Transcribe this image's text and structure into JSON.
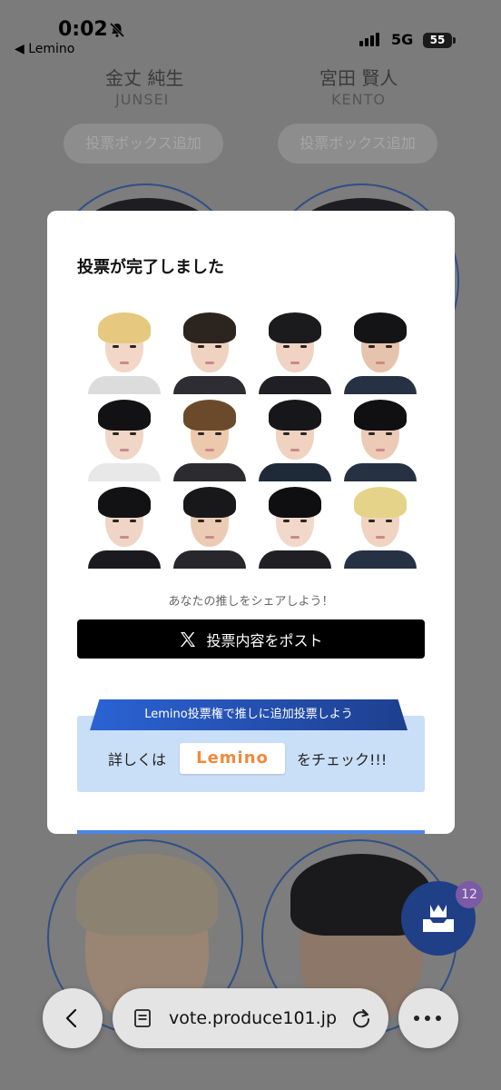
{
  "status_bar": {
    "time": "0:02",
    "back_app": "◀ Lemino",
    "network": "5G",
    "battery": "55"
  },
  "background": {
    "left_name": "金丈 純生",
    "left_roman": "JUNSEI",
    "right_name": "宮田 賢人",
    "right_roman": "KENTO",
    "add_box_label": "投票ボックス追加"
  },
  "modal": {
    "title": "投票が完了しました",
    "share_prompt": "あなたの推しをシェアしよう！",
    "post_button": "投票内容をポスト",
    "banner_text": "Lemino投票権で推しに追加投票しよう",
    "check_prefix": "詳しくは",
    "lemino_logo": "Lemino",
    "check_suffix": "をチェック!!!",
    "faces": [
      {
        "hair": "#e6c97e",
        "skin": "#f2d7c7",
        "shirt": "#dcdcdc"
      },
      {
        "hair": "#2c241f",
        "skin": "#efd2bf",
        "shirt": "#2d2d33"
      },
      {
        "hair": "#1b1b1e",
        "skin": "#f0d3c3",
        "shirt": "#202024"
      },
      {
        "hair": "#141416",
        "skin": "#e6c3ac",
        "shirt": "#263243"
      },
      {
        "hair": "#121215",
        "skin": "#f0d6c6",
        "shirt": "#e8e8e8"
      },
      {
        "hair": "#6b4a2c",
        "skin": "#ecc9ad",
        "shirt": "#2b2b30"
      },
      {
        "hair": "#17171a",
        "skin": "#f0d2c0",
        "shirt": "#1f2a38"
      },
      {
        "hair": "#101013",
        "skin": "#eccab6",
        "shirt": "#263243"
      },
      {
        "hair": "#121214",
        "skin": "#f0d5c6",
        "shirt": "#1b1b1f"
      },
      {
        "hair": "#18181b",
        "skin": "#eccbb4",
        "shirt": "#27272c"
      },
      {
        "hair": "#0f0f12",
        "skin": "#f2d8ca",
        "shirt": "#1f1f24"
      },
      {
        "hair": "#e5d38a",
        "skin": "#f0d3c0",
        "shirt": "#263243"
      }
    ]
  },
  "fab": {
    "badge": "12",
    "color": "#1f3f86"
  },
  "browser": {
    "url": "vote.produce101.jp"
  }
}
